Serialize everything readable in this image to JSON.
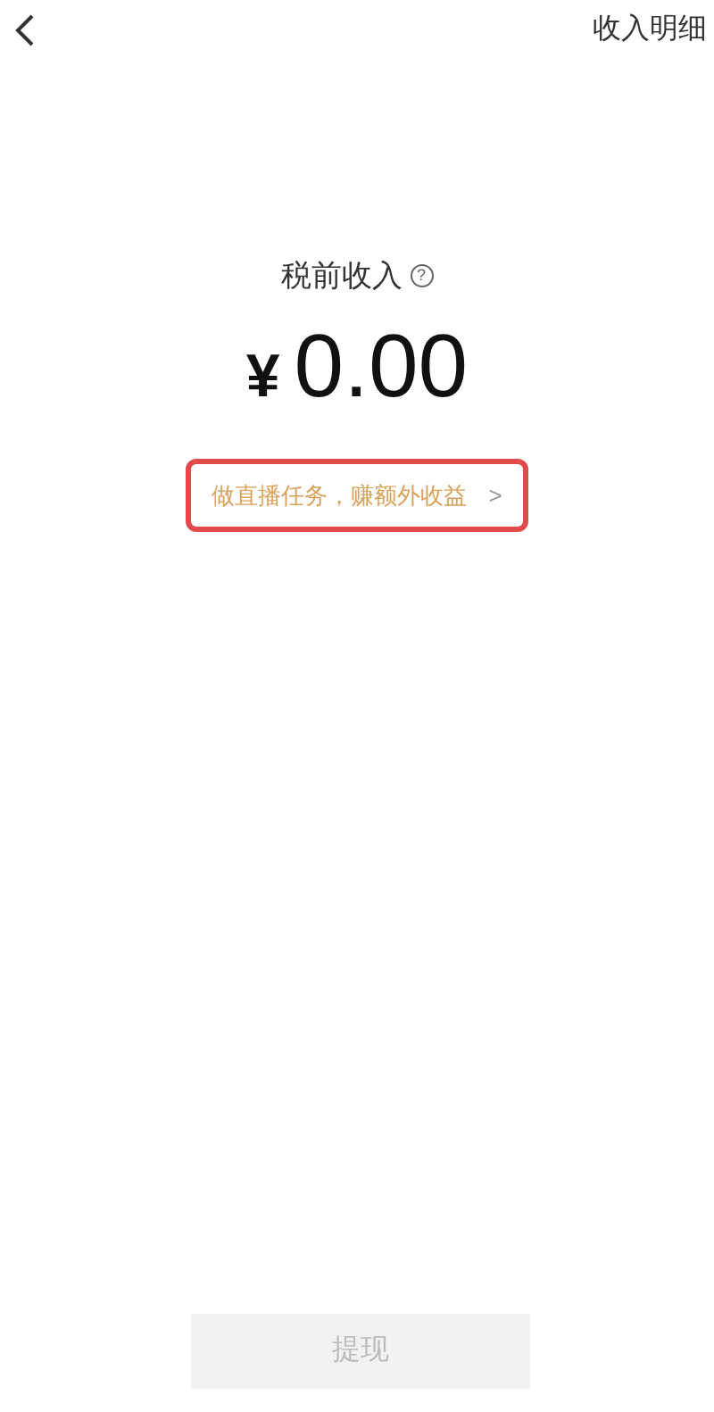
{
  "header": {
    "action": "收入明细"
  },
  "income": {
    "label": "税前收入",
    "help": "?",
    "currency": "¥",
    "amount": "0.00"
  },
  "promo": {
    "text": "做直播任务，赚额外收益",
    "arrow": ">",
    "highlighted": true
  },
  "withdraw_button": {
    "label": "提现",
    "disabled": true
  }
}
